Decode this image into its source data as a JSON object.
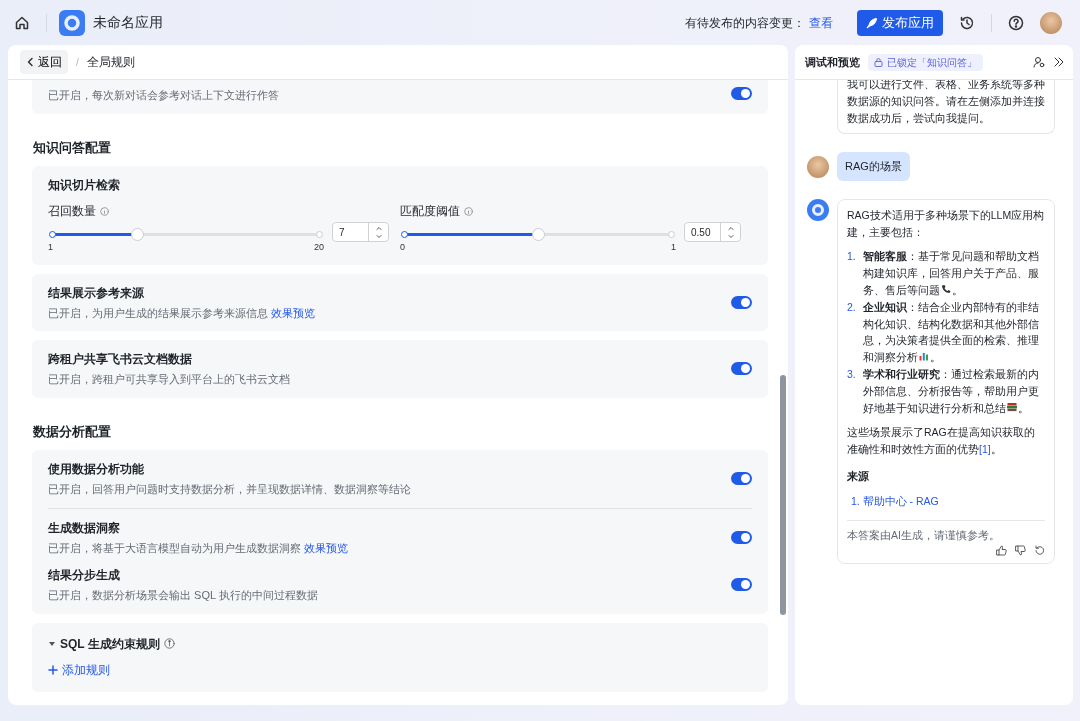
{
  "header": {
    "app_name": "未命名应用",
    "pending_label": "有待发布的内容变更：",
    "pending_link": "查看",
    "publish_button": "发布应用"
  },
  "breadcrumb": {
    "back": "返回",
    "separator": "/",
    "current": "全局规则"
  },
  "sections": [
    {
      "cards": [
        {
          "rows": [
            {
              "kind": "toggle",
              "description": "已开启，每次新对话会参考对话上下文进行作答",
              "on": true
            }
          ]
        }
      ]
    },
    {
      "heading": "知识问答配置",
      "cards": [
        {
          "rows": [
            {
              "kind": "sliders",
              "title": "知识切片检索",
              "sliders": [
                {
                  "label": "召回数量",
                  "min": "1",
                  "max": "20",
                  "value": "7",
                  "level": 0.316
                },
                {
                  "label": "匹配度阈值",
                  "min": "0",
                  "max": "1",
                  "value": "0.50",
                  "level": 0.5
                }
              ]
            }
          ]
        },
        {
          "rows": [
            {
              "kind": "toggle",
              "title": "结果展示参考来源",
              "description": "已开启，为用户生成的结果展示参考来源信息",
              "link": "效果预览",
              "on": true
            }
          ]
        },
        {
          "rows": [
            {
              "kind": "toggle",
              "title": "跨租户共享飞书云文档数据",
              "description": "已开启，跨租户可共享导入到平台上的飞书云文档",
              "on": true
            }
          ]
        }
      ]
    },
    {
      "heading": "数据分析配置",
      "cards": [
        {
          "rows": [
            {
              "kind": "toggle",
              "title": "使用数据分析功能",
              "description": "已开启，回答用户问题时支持数据分析，并呈现数据详情、数据洞察等结论",
              "on": true,
              "divider": true
            },
            {
              "kind": "toggle",
              "title": "生成数据洞察",
              "description": "已开启，将基于大语言模型自动为用户生成数据洞察",
              "link": "效果预览",
              "on": true
            },
            {
              "kind": "toggle",
              "title": "结果分步生成",
              "description": "已开启，数据分析场景会输出 SQL 执行的中间过程数据",
              "on": true
            }
          ]
        },
        {
          "rows": [
            {
              "kind": "rules",
              "title": "SQL 生成约束规则",
              "expanded": true,
              "add": "添加规则"
            }
          ]
        }
      ]
    }
  ],
  "preview": {
    "title": "调试和预览",
    "lock_badge": "已锁定「知识问答」",
    "messages": [
      {
        "kind": "bot",
        "avatar": false,
        "paragraphs": [
          "我可以进行文件、表格、业务系统等多种数据源的知识问答。请在左侧添加并连接数据成功后，尝试向我提问。"
        ]
      },
      {
        "kind": "user",
        "text": "RAG的场景"
      },
      {
        "kind": "bot",
        "avatar": true,
        "paragraphs": [
          "RAG技术适用于多种场景下的LLM应用构建，主要包括："
        ],
        "list": [
          {
            "number": "1.",
            "text": "**智能客服**：基于常见问题和帮助文档构建知识库，回答用户关于产品、服务、售后等问题",
            "kind": "phone",
            "end": "。"
          },
          {
            "number": "2.",
            "text": "**企业知识**：结合企业内部特有的非结构化知识、结构化数据和其他外部信息，为决策者提供全面的检索、推理和洞察分析",
            "kind": "chart",
            "end": "。"
          },
          {
            "number": "3.",
            "text": "**学术和行业研究**：通过检索最新的内外部信息、分析报告等，帮助用户更好地基于知识进行分析和总结",
            "kind": "books",
            "end": "。"
          }
        ],
        "closing": "这些场景展示了RAG在提高知识获取的准确性和时效性方面的优势",
        "citation": "[1]",
        "closing_end": "。",
        "sources_title": "来源",
        "sources": [
          {
            "number": "1.",
            "title": "帮助中心 - RAG"
          }
        ],
        "disclaimer": "本答案由AI生成，请谨慎参考。"
      }
    ]
  }
}
